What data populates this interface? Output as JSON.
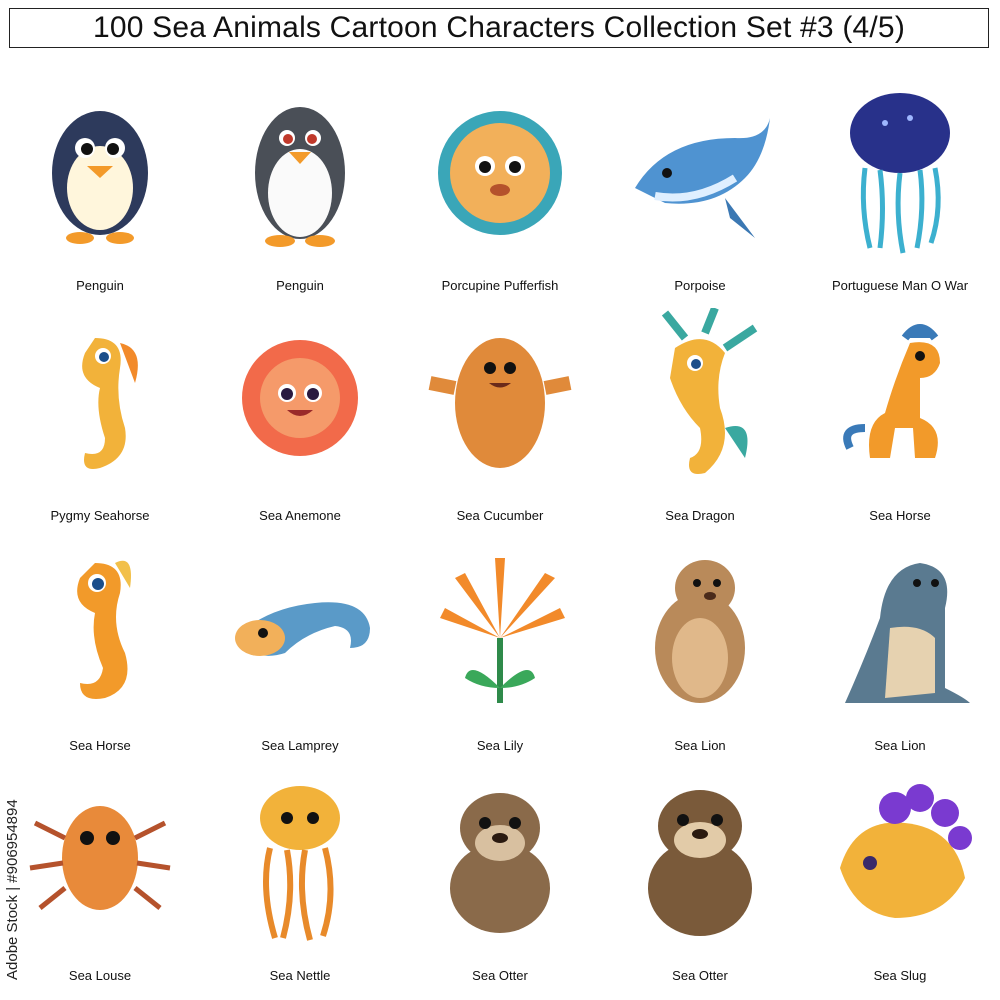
{
  "title": "100 Sea Animals Cartoon Characters Collection Set #3 (4/5)",
  "side_credit": "Adobe Stock | #906954894",
  "items": [
    {
      "label": "Penguin",
      "icon": "penguin-icon"
    },
    {
      "label": "Penguin",
      "icon": "penguin-icon"
    },
    {
      "label": "Porcupine Pufferfish",
      "icon": "pufferfish-icon"
    },
    {
      "label": "Porpoise",
      "icon": "porpoise-icon"
    },
    {
      "label": "Portuguese Man O War",
      "icon": "jellyfish-icon"
    },
    {
      "label": "Pygmy Seahorse",
      "icon": "seahorse-icon"
    },
    {
      "label": "Sea Anemone",
      "icon": "sea-anemone-icon"
    },
    {
      "label": "Sea Cucumber",
      "icon": "sea-cucumber-icon"
    },
    {
      "label": "Sea Dragon",
      "icon": "sea-dragon-icon"
    },
    {
      "label": "Sea Horse",
      "icon": "seahorse-icon"
    },
    {
      "label": "Sea Horse",
      "icon": "seahorse-icon"
    },
    {
      "label": "Sea Lamprey",
      "icon": "sea-lamprey-icon"
    },
    {
      "label": "Sea Lily",
      "icon": "sea-lily-icon"
    },
    {
      "label": "Sea Lion",
      "icon": "sea-lion-icon"
    },
    {
      "label": "Sea Lion",
      "icon": "sea-lion-icon"
    },
    {
      "label": "Sea Louse",
      "icon": "sea-louse-icon"
    },
    {
      "label": "Sea Nettle",
      "icon": "jellyfish-icon"
    },
    {
      "label": "Sea Otter",
      "icon": "sea-otter-icon"
    },
    {
      "label": "Sea Otter",
      "icon": "sea-otter-icon"
    },
    {
      "label": "Sea Slug",
      "icon": "sea-slug-icon"
    }
  ]
}
